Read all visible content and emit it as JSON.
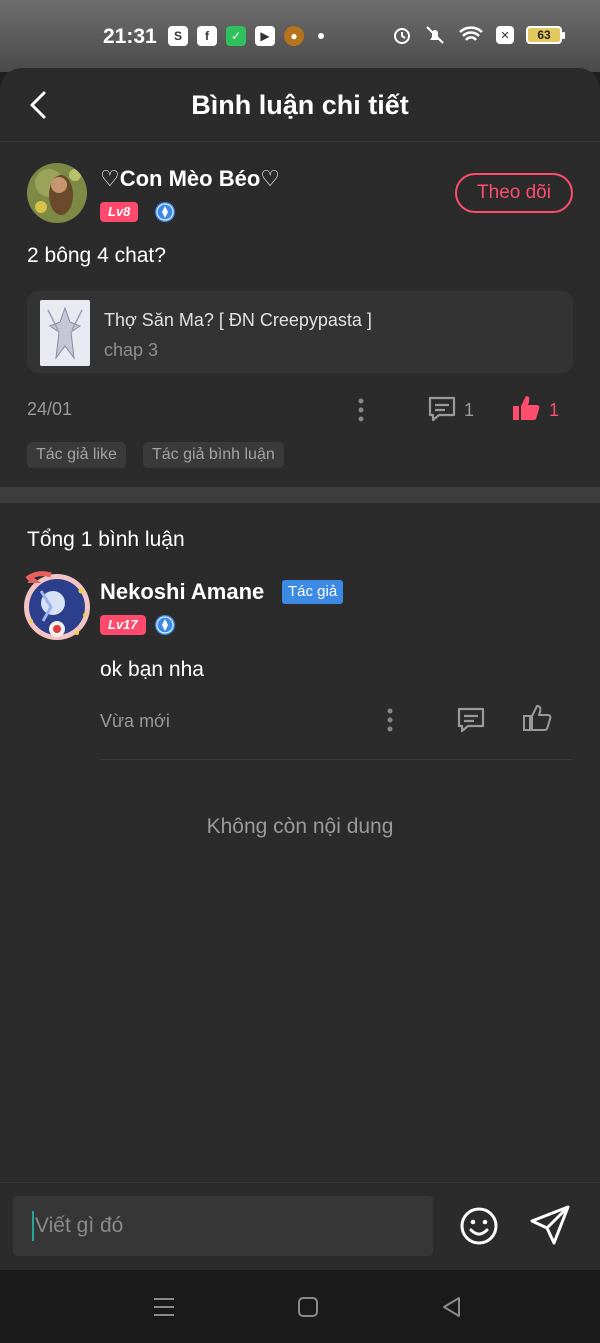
{
  "status_bar": {
    "time": "21:31",
    "battery": "63"
  },
  "header": {
    "title": "Bình luận chi tiết"
  },
  "post": {
    "username": "♡Con Mèo Béo♡",
    "level": "Lv8",
    "follow_label": "Theo dõi",
    "text": "2 bông 4 chat?",
    "book": {
      "title": "Thợ Săn Ma? [ ĐN Creepypasta ]",
      "chapter": "chap 3"
    },
    "date": "24/01",
    "comment_count": "1",
    "like_count": "1",
    "tags": [
      "Tác giả like",
      "Tác giả bình luận"
    ]
  },
  "comments": {
    "total_label": "Tổng 1 bình luận",
    "items": [
      {
        "name": "Nekoshi Amane",
        "author_tag": "Tác giả",
        "level": "Lv17",
        "text": "ok bạn nha",
        "time": "Vừa mới"
      }
    ],
    "end_label": "Không còn nội dung"
  },
  "input": {
    "placeholder": "Viết gì đó"
  },
  "colors": {
    "accent": "#ff4d6d",
    "author_tag": "#3c8ae4",
    "background": "#2b2b2b"
  }
}
